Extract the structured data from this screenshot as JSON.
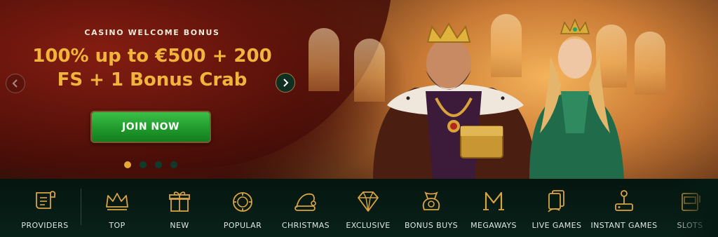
{
  "colors": {
    "accent_gold": "#e6a837",
    "headline": "#f2b53b",
    "button_green": "#1f9a2b",
    "nav_bg": "#061a14",
    "nav_label": "#dfe6e1"
  },
  "hero": {
    "eyebrow": "CASINO WELCOME BONUS",
    "headline_line1": "100% up to €500 + 200",
    "headline_line2": "FS + 1 Bonus Crab",
    "cta_label": "JOIN NOW",
    "slides_total": 4,
    "active_slide": 1
  },
  "nav": {
    "items": [
      {
        "label": "PROVIDERS",
        "icon": "scroll-icon"
      },
      {
        "label": "TOP",
        "icon": "crown-icon"
      },
      {
        "label": "NEW",
        "icon": "gift-box-icon"
      },
      {
        "label": "POPULAR",
        "icon": "poker-chip-icon"
      },
      {
        "label": "CHRISTMAS",
        "icon": "santa-hat-icon"
      },
      {
        "label": "EXCLUSIVE",
        "icon": "diamond-icon"
      },
      {
        "label": "BONUS BUYS",
        "icon": "bonus-bag-icon"
      },
      {
        "label": "MEGAWAYS",
        "icon": "megaways-m-icon"
      },
      {
        "label": "LIVE GAMES",
        "icon": "cards-hand-icon"
      },
      {
        "label": "INSTANT GAMES",
        "icon": "joystick-icon"
      },
      {
        "label": "SLOTS",
        "icon": "slot-machine-icon"
      }
    ]
  }
}
